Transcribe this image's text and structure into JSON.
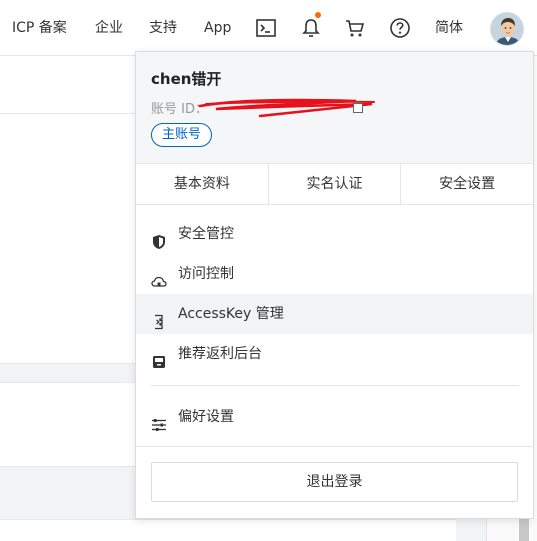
{
  "nav": {
    "icp": "ICP 备案",
    "enterprise": "企业",
    "support": "支持",
    "app": "App",
    "language": "简体"
  },
  "colors": {
    "accent": "#0064c8",
    "notification_dot": "#ff6a00",
    "redaction": "#e8101a",
    "hover_bg": "#f2f3f5"
  },
  "user": {
    "name": "chen错开",
    "account_id_label": "账号 ID：",
    "badge": "主账号"
  },
  "tabs": [
    "基本资料",
    "实名认证",
    "安全设置"
  ],
  "menu": {
    "security_control": "安全管控",
    "access_control": "访问控制",
    "accesskey": "AccessKey 管理",
    "referral": "推荐返利后台",
    "preferences": "偏好设置"
  },
  "logout": "退出登录"
}
